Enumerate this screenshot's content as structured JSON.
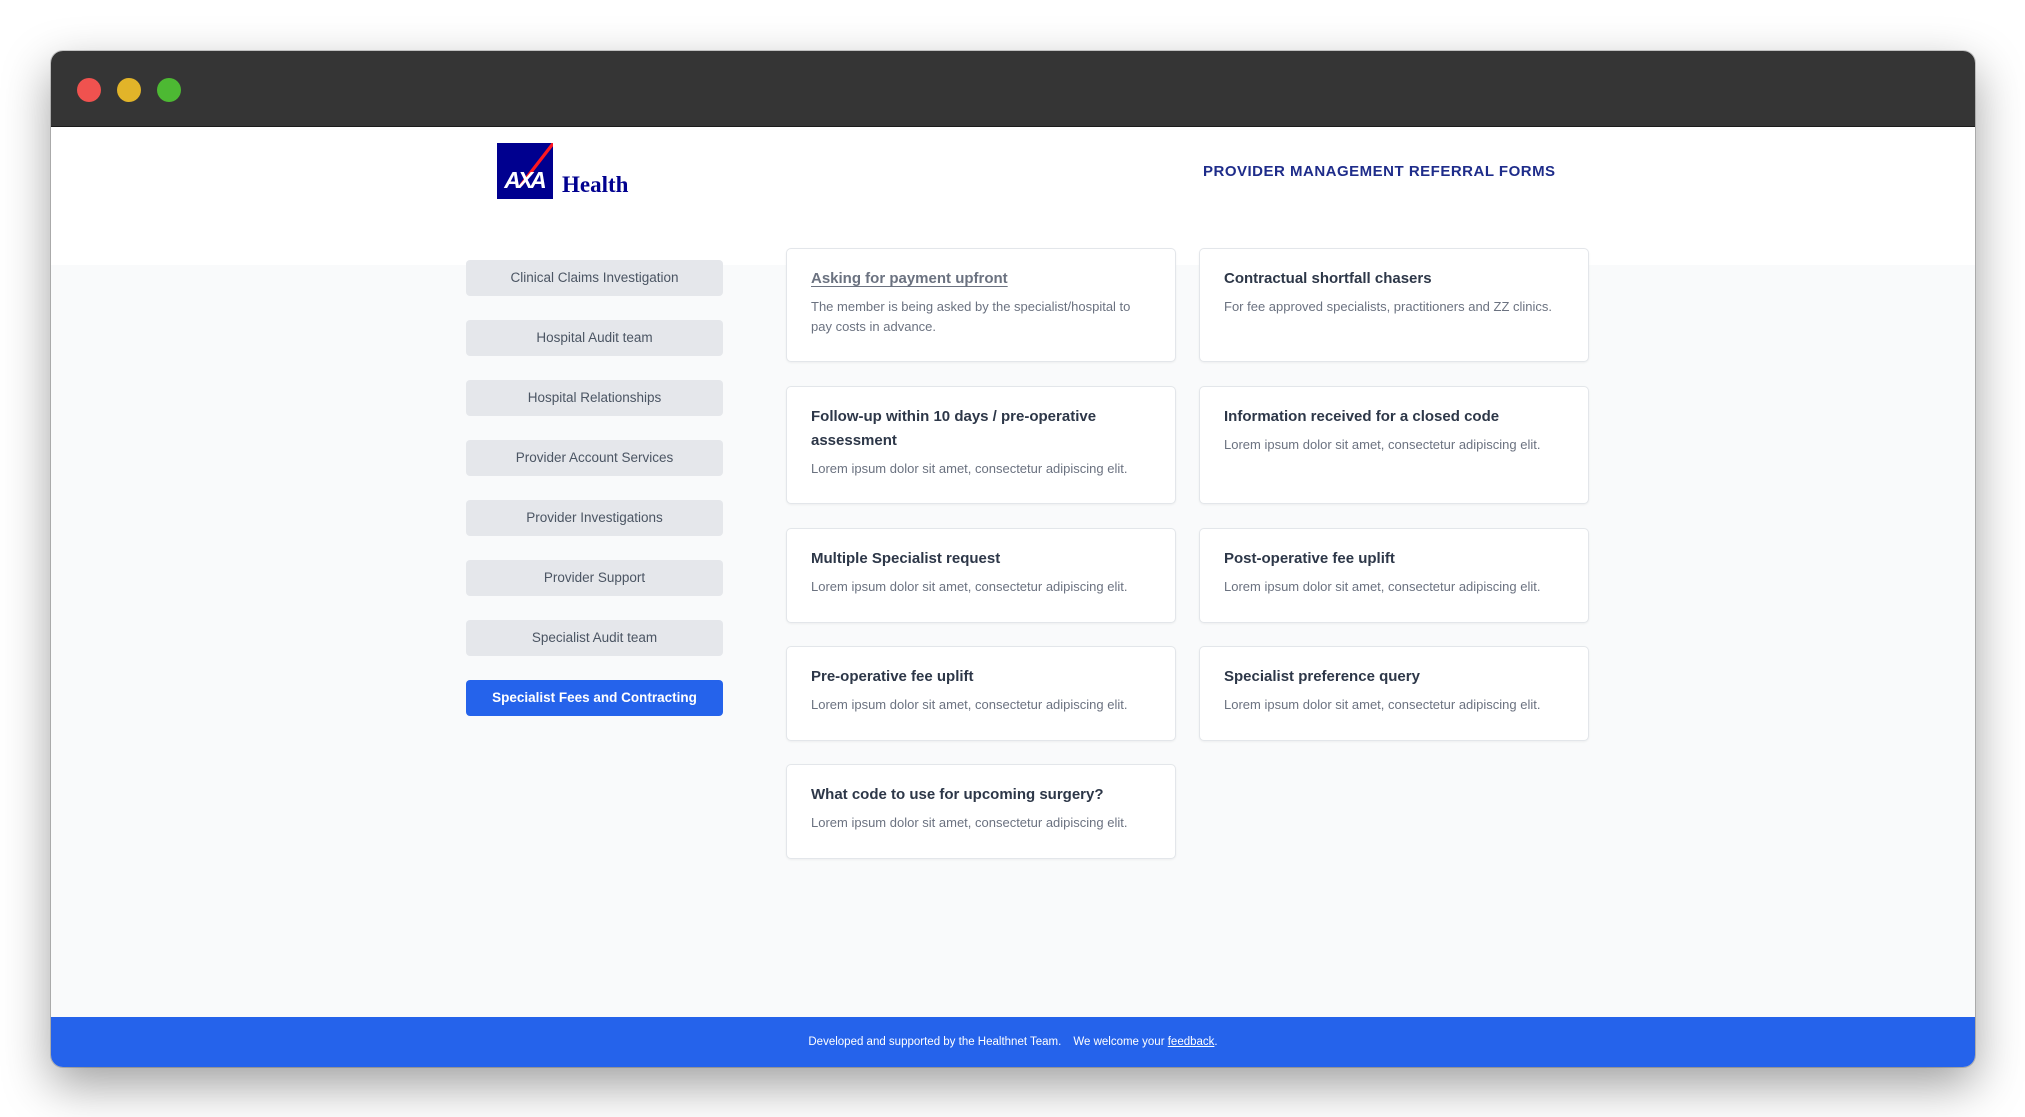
{
  "window": {
    "controls": [
      "close",
      "minimize",
      "maximize"
    ]
  },
  "header": {
    "logo_text": "Health",
    "logo_mark": "AXA",
    "title": "PROVIDER MANAGEMENT REFERRAL FORMS"
  },
  "sidebar": {
    "items": [
      {
        "label": "Clinical Claims Investigation",
        "active": false
      },
      {
        "label": "Hospital Audit team",
        "active": false
      },
      {
        "label": "Hospital Relationships",
        "active": false
      },
      {
        "label": "Provider Account Services",
        "active": false
      },
      {
        "label": "Provider Investigations",
        "active": false
      },
      {
        "label": "Provider Support",
        "active": false
      },
      {
        "label": "Specialist Audit team",
        "active": false
      },
      {
        "label": "Specialist Fees and Contracting",
        "active": true
      }
    ]
  },
  "cards": [
    {
      "title": "Asking for payment upfront",
      "desc": "The member is being asked by the specialist/hospital to pay costs in advance."
    },
    {
      "title": "Contractual shortfall chasers",
      "desc": "For fee approved specialists, practitioners and ZZ clinics."
    },
    {
      "title": "Follow-up within 10 days / pre-operative assessment",
      "desc": "Lorem ipsum dolor sit amet, consectetur adipiscing elit."
    },
    {
      "title": "Information received for a closed code",
      "desc": "Lorem ipsum dolor sit amet, consectetur adipiscing elit."
    },
    {
      "title": "Multiple Specialist request",
      "desc": "Lorem ipsum dolor sit amet, consectetur adipiscing elit."
    },
    {
      "title": "Post-operative fee uplift",
      "desc": "Lorem ipsum dolor sit amet, consectetur adipiscing elit."
    },
    {
      "title": "Pre-operative fee uplift",
      "desc": "Lorem ipsum dolor sit amet, consectetur adipiscing elit."
    },
    {
      "title": "Specialist preference query",
      "desc": "Lorem ipsum dolor sit amet, consectetur adipiscing elit."
    },
    {
      "title": "What code to use for upcoming surgery?",
      "desc": "Lorem ipsum dolor sit amet, consectetur adipiscing elit."
    }
  ],
  "footer": {
    "text": "Developed and supported by the Healthnet Team.",
    "welcome": "We welcome your",
    "link": "feedback",
    "period": "."
  },
  "colors": {
    "brand": "#00008f",
    "accent": "#2563eb",
    "titlebar": "#353535"
  }
}
